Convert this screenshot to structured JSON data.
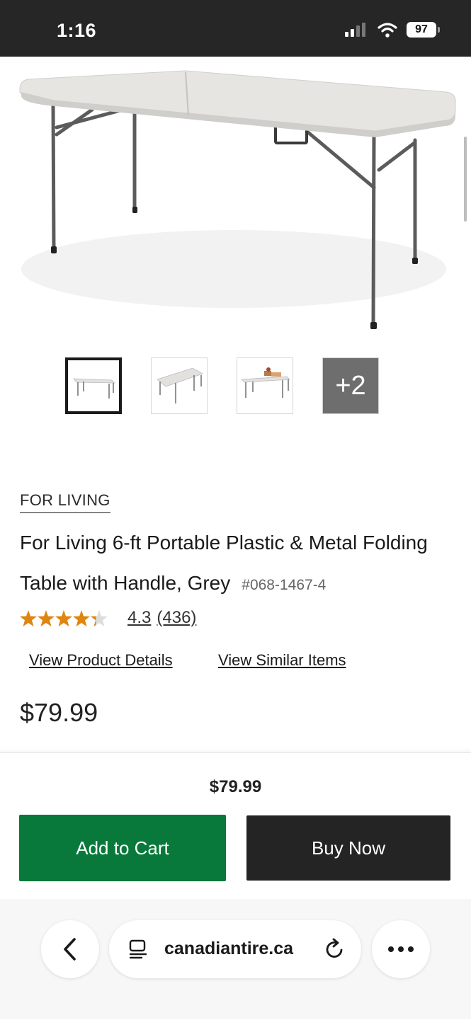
{
  "status_bar": {
    "time": "1:16",
    "battery": "97",
    "icons": [
      "signal-icon",
      "wifi-icon",
      "battery-icon"
    ]
  },
  "product": {
    "images": {
      "thumbnails": [
        "thumb-table-front",
        "thumb-table-angle",
        "thumb-table-with-items"
      ],
      "more_label": "+2",
      "selected_index": 0
    },
    "brand": "FOR LIVING",
    "title": "For Living 6-ft Portable Plastic & Metal Folding Table with Handle, Grey",
    "sku": "#068-1467-4",
    "rating": {
      "value": "4.3",
      "count": "(436)",
      "stars_filled": 4.3,
      "stars_max": 5
    },
    "links": {
      "details": "View Product Details",
      "similar": "View Similar Items"
    },
    "price": "$79.99"
  },
  "sticky_bar": {
    "price": "$79.99",
    "add_to_cart": "Add to Cart",
    "buy_now": "Buy Now"
  },
  "browser": {
    "url": "canadiantire.ca",
    "icons": [
      "back-icon",
      "page-icon",
      "reload-icon",
      "more-icon"
    ]
  },
  "colors": {
    "add_to_cart": "#08793a",
    "buy_now": "#242424",
    "status_bar": "#262626",
    "star": "#e0850f"
  }
}
